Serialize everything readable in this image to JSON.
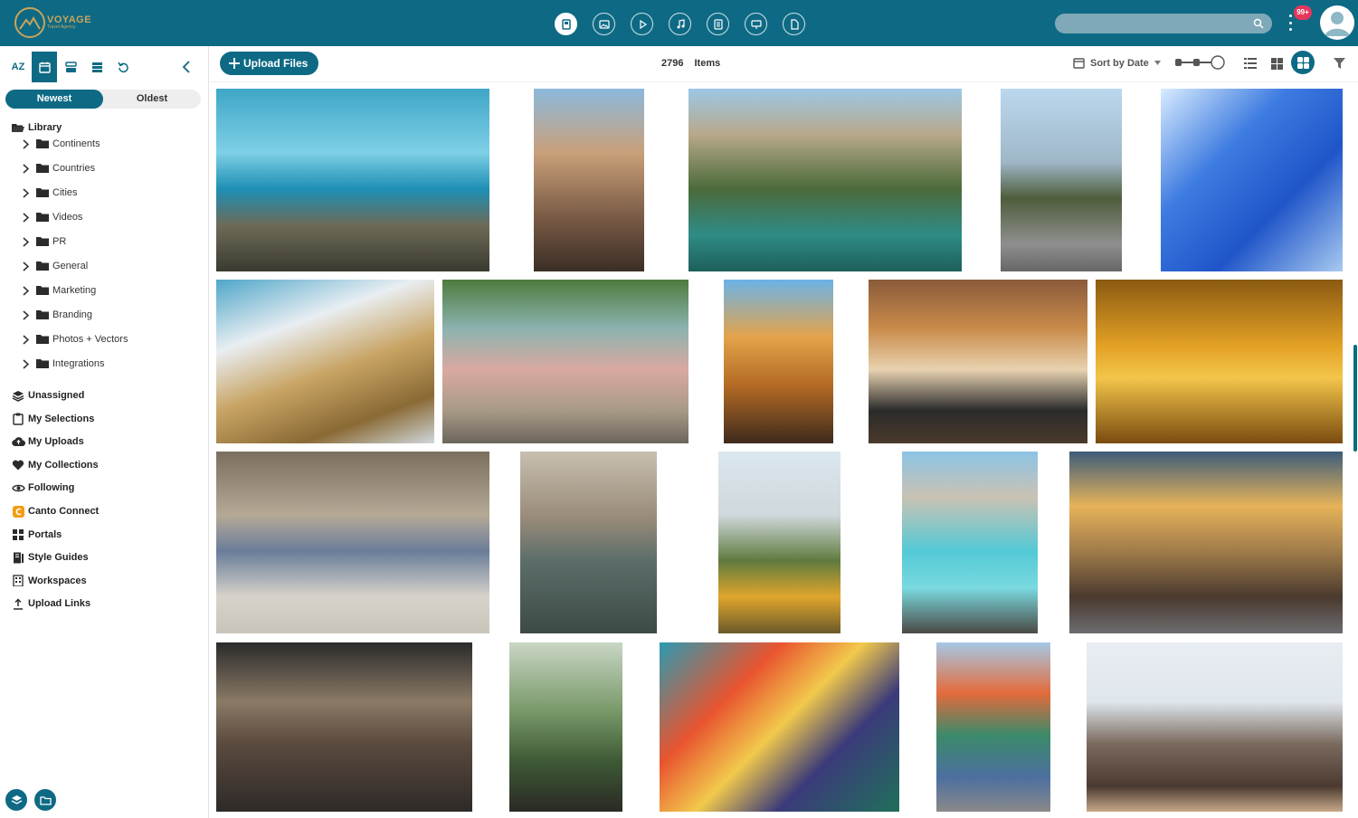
{
  "colors": {
    "brand": "#0e6a84",
    "brand_dark": "#0b5a70",
    "notification": "#e5365b",
    "logo_gold": "#c9a45c"
  },
  "header": {
    "logo_name": "VOYAGE",
    "logo_sub": "Travel Agency",
    "notification_badge": "99+",
    "type_icons": [
      "all-files-icon",
      "image-icon",
      "video-icon",
      "audio-icon",
      "document-icon",
      "presentation-icon",
      "other-icon"
    ]
  },
  "sidebar": {
    "tools": [
      "az-sort",
      "calendar-icon",
      "stack-icon",
      "database-icon",
      "refresh-icon",
      "collapse-icon"
    ],
    "tool_az": "AZ",
    "sort_newest": "Newest",
    "sort_oldest": "Oldest",
    "library_label": "Library",
    "library_children": [
      "Continents",
      "Countries",
      "Cities",
      "Videos",
      "PR",
      "General",
      "Marketing",
      "Branding",
      "Photos + Vectors",
      "Integrations"
    ],
    "nav": [
      {
        "label": "Unassigned",
        "icon": "layers-icon"
      },
      {
        "label": "My Selections",
        "icon": "clipboard-icon"
      },
      {
        "label": "My Uploads",
        "icon": "cloud-upload-icon"
      },
      {
        "label": "My Collections",
        "icon": "heart-icon"
      },
      {
        "label": "Following",
        "icon": "eye-icon"
      },
      {
        "label": "Canto Connect",
        "icon": "canto-icon"
      },
      {
        "label": "Portals",
        "icon": "grid-icon"
      },
      {
        "label": "Style Guides",
        "icon": "book-icon"
      },
      {
        "label": "Workspaces",
        "icon": "building-icon"
      },
      {
        "label": "Upload Links",
        "icon": "upload-icon"
      }
    ]
  },
  "toolbar": {
    "upload_label": "Upload Files",
    "item_count": "2796",
    "items_label": "Items",
    "sort_label": "Sort by Date"
  },
  "thumbnails": [
    {
      "name": "coastal-cliffs"
    },
    {
      "name": "casa-batllo"
    },
    {
      "name": "gorge-river"
    },
    {
      "name": "palm-avenue"
    },
    {
      "name": "blue-stairs"
    },
    {
      "name": "metropol-parasol"
    },
    {
      "name": "colorful-street"
    },
    {
      "name": "arched-courtyard"
    },
    {
      "name": "churros-coffee"
    },
    {
      "name": "golden-arches"
    },
    {
      "name": "street-musicians"
    },
    {
      "name": "aerial-city"
    },
    {
      "name": "palm-hill"
    },
    {
      "name": "turquoise-cove"
    },
    {
      "name": "cafe-street"
    },
    {
      "name": "busy-cafe"
    },
    {
      "name": "greenhouse"
    },
    {
      "name": "mural-friends"
    },
    {
      "name": "mural-group"
    },
    {
      "name": "sunset-friends"
    }
  ]
}
